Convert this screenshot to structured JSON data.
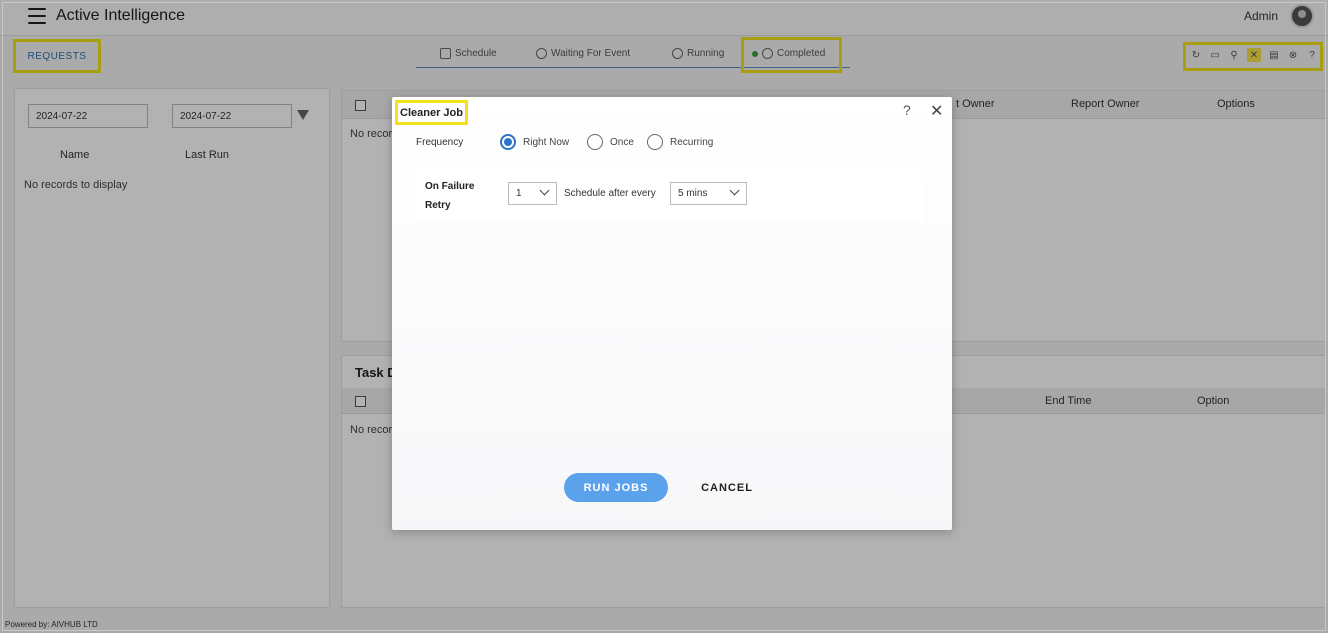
{
  "app": {
    "title": "Active Intelligence",
    "user": "Admin",
    "powered_by": "Powered by: AIVHUB LTD"
  },
  "requests_tab": "REQUESTS",
  "tabs": [
    {
      "label": "Schedule",
      "icon": "calendar-icon"
    },
    {
      "label": "Waiting For Event",
      "icon": "refresh-icon"
    },
    {
      "label": "Running",
      "icon": "running-icon"
    },
    {
      "label": "Completed",
      "icon": "check-circle-icon",
      "status_color": "#3aa13a"
    }
  ],
  "toolbar": [
    {
      "name": "refresh-icon",
      "glyph": "↻"
    },
    {
      "name": "comment-icon",
      "glyph": "▭"
    },
    {
      "name": "user-icon",
      "glyph": "⚲"
    },
    {
      "name": "cancel-x-icon",
      "glyph": "✕"
    },
    {
      "name": "archive-icon",
      "glyph": "▤"
    },
    {
      "name": "stop-circle-icon",
      "glyph": "⊗"
    },
    {
      "name": "help-icon",
      "glyph": "?"
    }
  ],
  "left_panel": {
    "date_from": "2024-07-22",
    "date_to": "2024-07-22",
    "columns": [
      "Name",
      "Last Run"
    ],
    "empty": "No records to display"
  },
  "right_top": {
    "columns": [
      "t Owner",
      "Report Owner",
      "Options"
    ],
    "empty": "No recor"
  },
  "right_bottom": {
    "title": "Task D",
    "columns": [
      "End Time",
      "Option"
    ],
    "empty": "No recor"
  },
  "modal": {
    "title": "Cleaner Job",
    "help": "?",
    "close": "✕",
    "frequency_label": "Frequency",
    "options": [
      "Right Now",
      "Once",
      "Recurring"
    ],
    "selected": "Right Now",
    "retry_label": "On Failure Retry",
    "retry_value": "1",
    "schedule_label": "Schedule after every",
    "schedule_value": "5 mins",
    "run_label": "RUN JOBS",
    "cancel_label": "CANCEL"
  },
  "colors": {
    "accent": "#5aa2ec",
    "highlight": "#f2e21a",
    "radio": "#2a73c9"
  }
}
